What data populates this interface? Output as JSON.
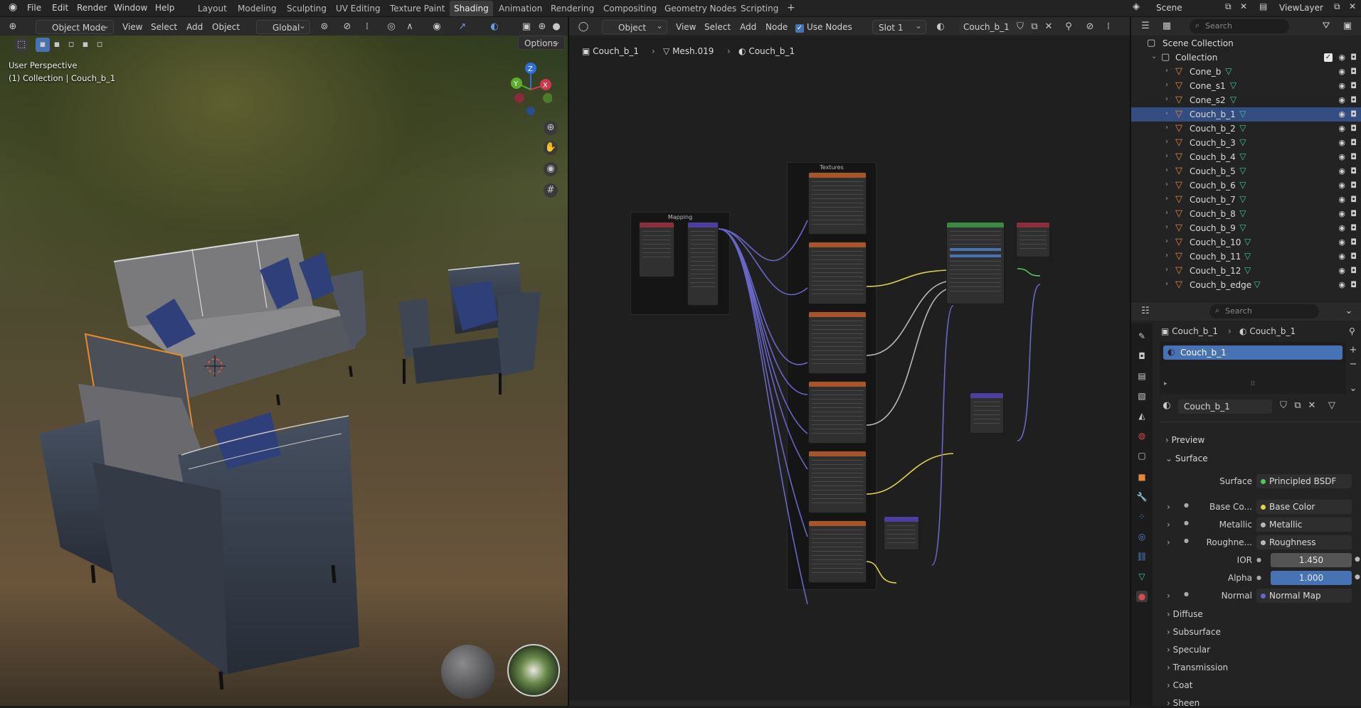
{
  "menu": {
    "file": "File",
    "edit": "Edit",
    "render": "Render",
    "window": "Window",
    "help": "Help"
  },
  "workspaces": [
    "Layout",
    "Modeling",
    "Sculpting",
    "UV Editing",
    "Texture Paint",
    "Shading",
    "Animation",
    "Rendering",
    "Compositing",
    "Geometry Nodes",
    "Scripting"
  ],
  "active_workspace": "Shading",
  "scene": {
    "name": "Scene",
    "view_layer": "ViewLayer"
  },
  "viewport": {
    "mode": "Object Mode",
    "view": "View",
    "select": "Select",
    "add": "Add",
    "object": "Object",
    "orientation": "Global",
    "options": "Options",
    "perspective": "User Perspective",
    "collection_info": "(1) Collection | Couch_b_1",
    "gizmo": {
      "z": "Z",
      "y": "Y",
      "x": "X"
    }
  },
  "node_editor": {
    "type": "Object",
    "view": "View",
    "select": "Select",
    "add": "Add",
    "node": "Node",
    "use_nodes": "Use Nodes",
    "slot": "Slot 1",
    "material": "Couch_b_1",
    "breadcrumb": [
      "Couch_b_1",
      "Mesh.019",
      "Couch_b_1"
    ],
    "frames": {
      "mapping": "Mapping",
      "textures": "Textures"
    }
  },
  "outliner": {
    "search_placeholder": "Search",
    "scene_collection": "Scene Collection",
    "collection": "Collection",
    "items": [
      "Cone_b",
      "Cone_s1",
      "Cone_s2",
      "Couch_b_1",
      "Couch_b_2",
      "Couch_b_3",
      "Couch_b_4",
      "Couch_b_5",
      "Couch_b_6",
      "Couch_b_7",
      "Couch_b_8",
      "Couch_b_9",
      "Couch_b_10",
      "Couch_b_11",
      "Couch_b_12",
      "Couch_b_edge"
    ],
    "selected": "Couch_b_1"
  },
  "properties": {
    "search_placeholder": "Search",
    "crumb_object": "Couch_b_1",
    "crumb_material": "Couch_b_1",
    "slot_name": "Couch_b_1",
    "material_name": "Couch_b_1",
    "preview": "Preview",
    "surface_panel": "Surface",
    "surface_label": "Surface",
    "surface_value": "Principled BSDF",
    "base_color_label": "Base Co...",
    "base_color_value": "Base Color",
    "metallic_label": "Metallic",
    "metallic_value": "Metallic",
    "roughness_label": "Roughne...",
    "roughness_value": "Roughness",
    "ior_label": "IOR",
    "ior_value": "1.450",
    "alpha_label": "Alpha",
    "alpha_value": "1.000",
    "normal_label": "Normal",
    "normal_value": "Normal Map",
    "subpanels": [
      "Diffuse",
      "Subsurface",
      "Specular",
      "Transmission",
      "Coat",
      "Sheen"
    ]
  },
  "colors": {
    "accent": "#4772b3",
    "selection": "#334d80",
    "object_orange": "#e0883a",
    "mesh_green": "#39c8a6"
  }
}
